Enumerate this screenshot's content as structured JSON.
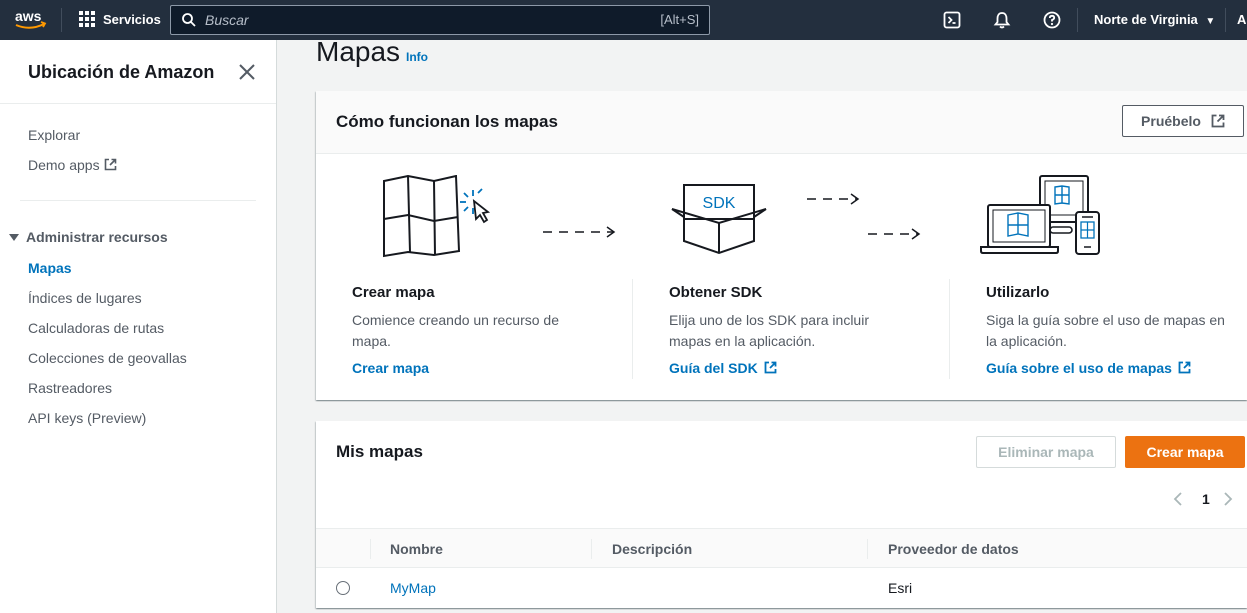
{
  "topnav": {
    "logo_text": "aws",
    "services_label": "Servicios",
    "search_placeholder": "Buscar",
    "search_shortcut": "[Alt+S]",
    "region": "Norte de Virginia",
    "account_partial": "A"
  },
  "sidebar": {
    "title": "Ubicación de Amazon",
    "links": [
      "Explorar",
      "Demo apps"
    ],
    "section_title": "Administrar recursos",
    "items": [
      {
        "label": "Mapas",
        "active": true
      },
      {
        "label": "Índices de lugares",
        "active": false
      },
      {
        "label": "Calculadoras de rutas",
        "active": false
      },
      {
        "label": "Colecciones de geovallas",
        "active": false
      },
      {
        "label": "Rastreadores",
        "active": false
      },
      {
        "label": "API keys (Preview)",
        "active": false
      }
    ]
  },
  "page": {
    "title": "Mapas",
    "info": "Info"
  },
  "how_it_works": {
    "title": "Cómo funcionan los mapas",
    "try_button": "Pruébelo",
    "sdk_label": "SDK",
    "steps": [
      {
        "title": "Crear mapa",
        "desc": "Comience creando un recurso de mapa.",
        "link": "Crear mapa"
      },
      {
        "title": "Obtener SDK",
        "desc": "Elija uno de los SDK para incluir mapas en la aplicación.",
        "link": "Guía del SDK"
      },
      {
        "title": "Utilizarlo",
        "desc": "Siga la guía sobre el uso de mapas en la aplicación.",
        "link": "Guía sobre el uso de mapas"
      }
    ]
  },
  "my_maps": {
    "title": "Mis mapas",
    "delete_button": "Eliminar mapa",
    "create_button": "Crear mapa",
    "page_number": "1",
    "columns": [
      "Nombre",
      "Descripción",
      "Proveedor de datos"
    ],
    "rows": [
      {
        "name": "MyMap",
        "description": "",
        "provider": "Esri"
      }
    ]
  },
  "colors": {
    "nav_bg": "#232f3e",
    "link": "#0073bb",
    "primary": "#ec7211",
    "aws_smile": "#ff9900"
  }
}
